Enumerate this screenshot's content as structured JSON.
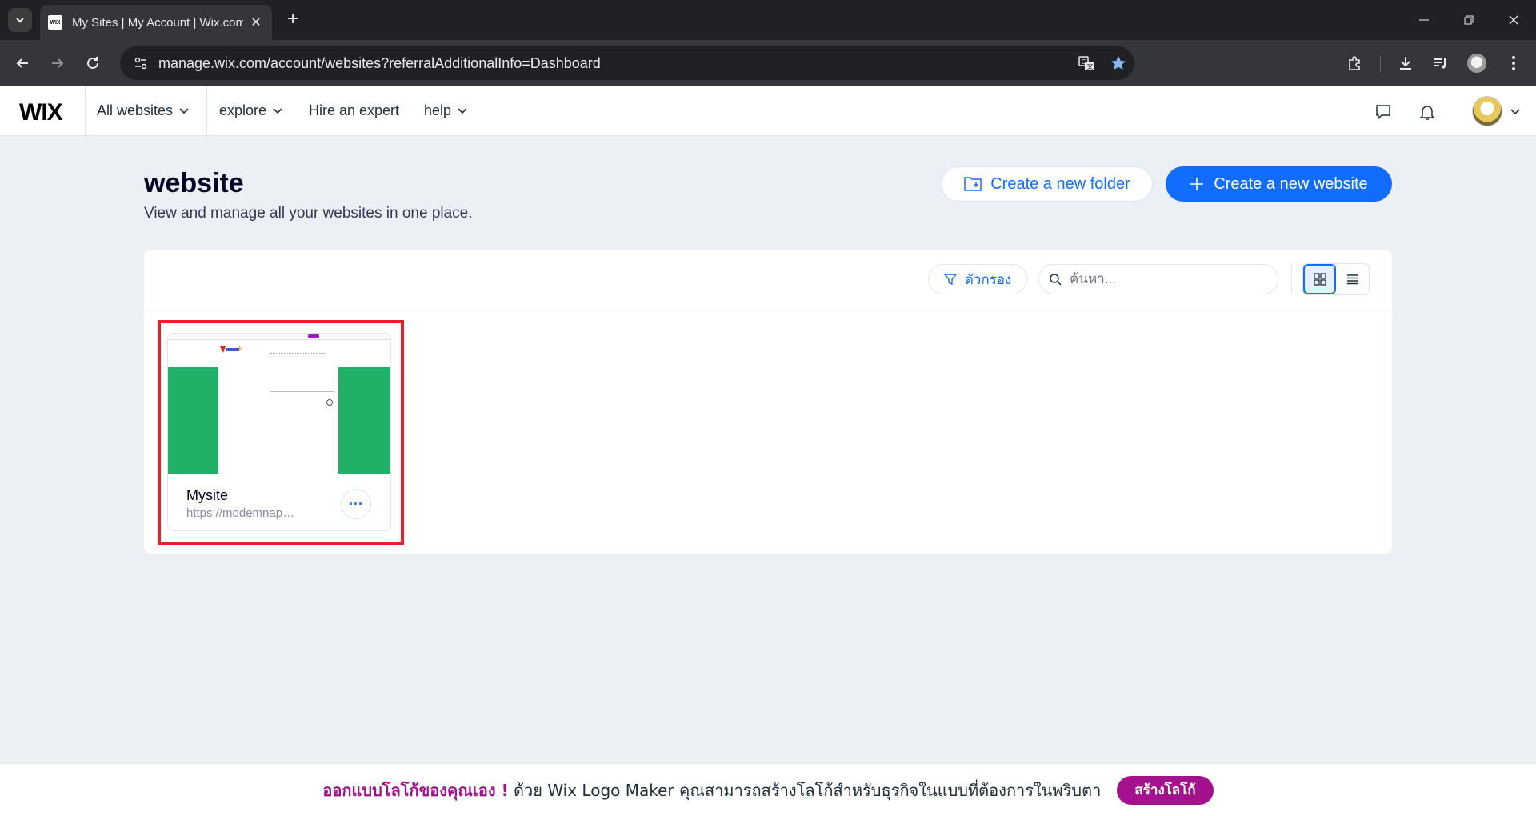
{
  "browser": {
    "tab_title": "My Sites | My Account | Wix.com",
    "favicon_text": "WIX",
    "url": "manage.wix.com/account/websites?referralAdditionalInfo=Dashboard"
  },
  "header": {
    "logo": "WIX",
    "nav": {
      "all_websites": "All websites",
      "explore": "explore",
      "hire_expert": "Hire an expert",
      "help": "help"
    }
  },
  "page": {
    "title": "website",
    "subtitle": "View and manage all your websites in one place.",
    "create_folder": "Create a new folder",
    "create_website": "Create a new website"
  },
  "toolbar": {
    "filter_label": "ตัวกรอง",
    "search_placeholder": "ค้นหา..."
  },
  "sites": [
    {
      "name": "Mysite",
      "url": "https://modemnaphat..."
    }
  ],
  "promo": {
    "headline": "ออกแบบโลโก้ของคุณเอง !",
    "body": " ด้วย Wix Logo Maker คุณสามารถสร้างโลโก้สำหรับธุรกิจในแบบที่ต้องการในพริบตา",
    "button": "สร้างโลโก้"
  },
  "colors": {
    "accent": "#116dff",
    "promo": "#a3128c",
    "highlight": "#e3202b",
    "thumb_green": "#22b068"
  }
}
